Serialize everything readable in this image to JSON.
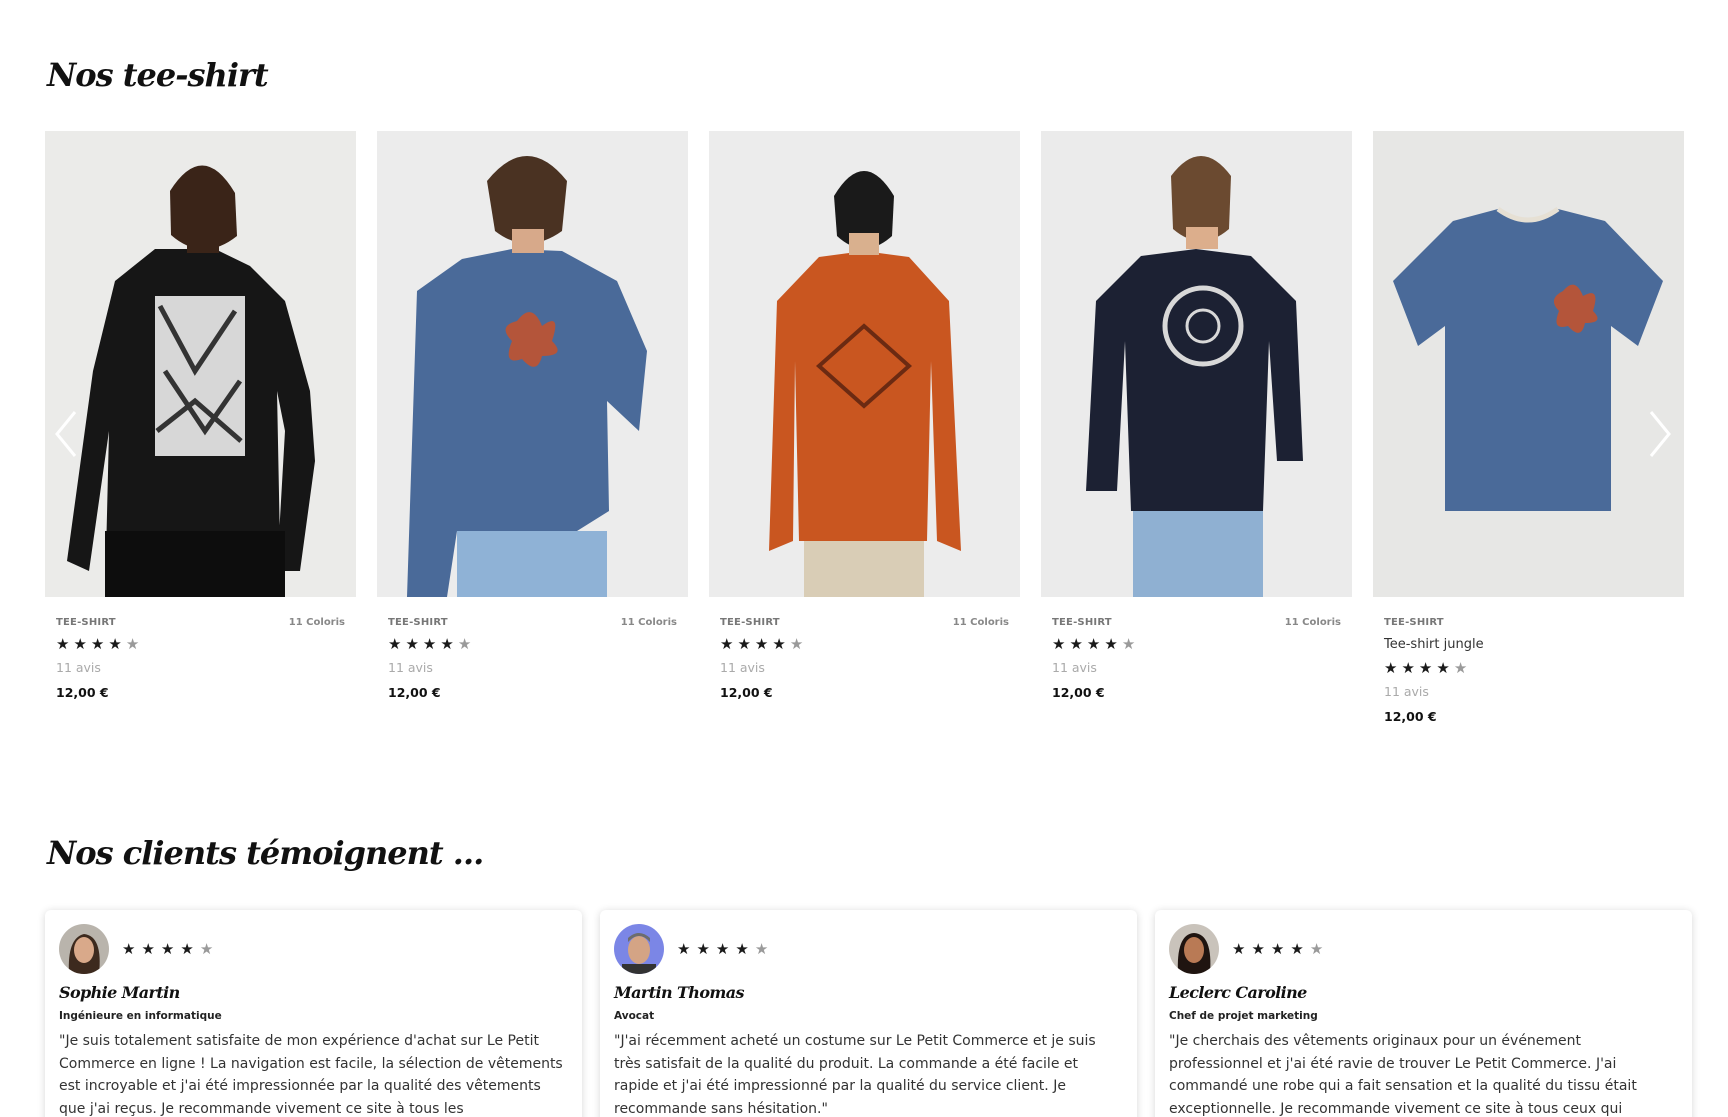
{
  "products_section": {
    "title": "Nos tee-shirt"
  },
  "products": [
    {
      "category": "TEE-SHIRT",
      "colors": "11 Coloris",
      "rating": 4,
      "reviews": "11 avis",
      "price": "12,00 €",
      "shirt_color": "#161616"
    },
    {
      "category": "TEE-SHIRT",
      "colors": "11 Coloris",
      "rating": 4,
      "reviews": "11 avis",
      "price": "12,00 €",
      "shirt_color": "#4a6a99"
    },
    {
      "category": "TEE-SHIRT",
      "colors": "11 Coloris",
      "rating": 4,
      "reviews": "11 avis",
      "price": "12,00 €",
      "shirt_color": "#c95620"
    },
    {
      "category": "TEE-SHIRT",
      "colors": "11 Coloris",
      "rating": 4,
      "reviews": "11 avis",
      "price": "12,00 €",
      "shirt_color": "#1c2133"
    },
    {
      "category": "TEE-SHIRT",
      "name": "Tee-shirt jungle",
      "rating": 4,
      "reviews": "11 avis",
      "price": "12,00 €",
      "shirt_color": "#4a6a99"
    }
  ],
  "carousel": {
    "prev_icon": "chevron-left-icon",
    "next_icon": "chevron-right-icon"
  },
  "reviews_section": {
    "title": "Nos clients témoignent ..."
  },
  "testimonials": [
    {
      "name": "Sophie Martin",
      "role": "Ingénieure en informatique",
      "rating": 4,
      "text": "\"Je suis totalement satisfaite de mon expérience d'achat sur Le Petit Commerce en ligne ! La navigation est facile, la sélection de vêtements est incroyable et j'ai été impressionnée par la qualité des vêtements que j'ai reçus. Je recommande vivement ce site à tous les",
      "avatar_bg": "#b9b4ac"
    },
    {
      "name": "Martin Thomas",
      "role": "Avocat",
      "rating": 4,
      "text": "\"J'ai récemment acheté un costume sur Le Petit Commerce et je suis très satisfait de la qualité du produit. La commande a été facile et rapide et j'ai été impressionné par la qualité du service client. Je recommande sans hésitation.\"",
      "avatar_bg": "#7b86e6"
    },
    {
      "name": "Leclerc Caroline",
      "role": "Chef de projet marketing",
      "rating": 4,
      "text": "\"Je cherchais des vêtements originaux pour un événement professionnel et j'ai été ravie de trouver Le Petit Commerce. J'ai commandé une robe qui a fait sensation et la qualité du tissu était exceptionnelle. Je recommande vivement ce site à tous ceux qui",
      "avatar_bg": "#c9c3bb"
    }
  ]
}
